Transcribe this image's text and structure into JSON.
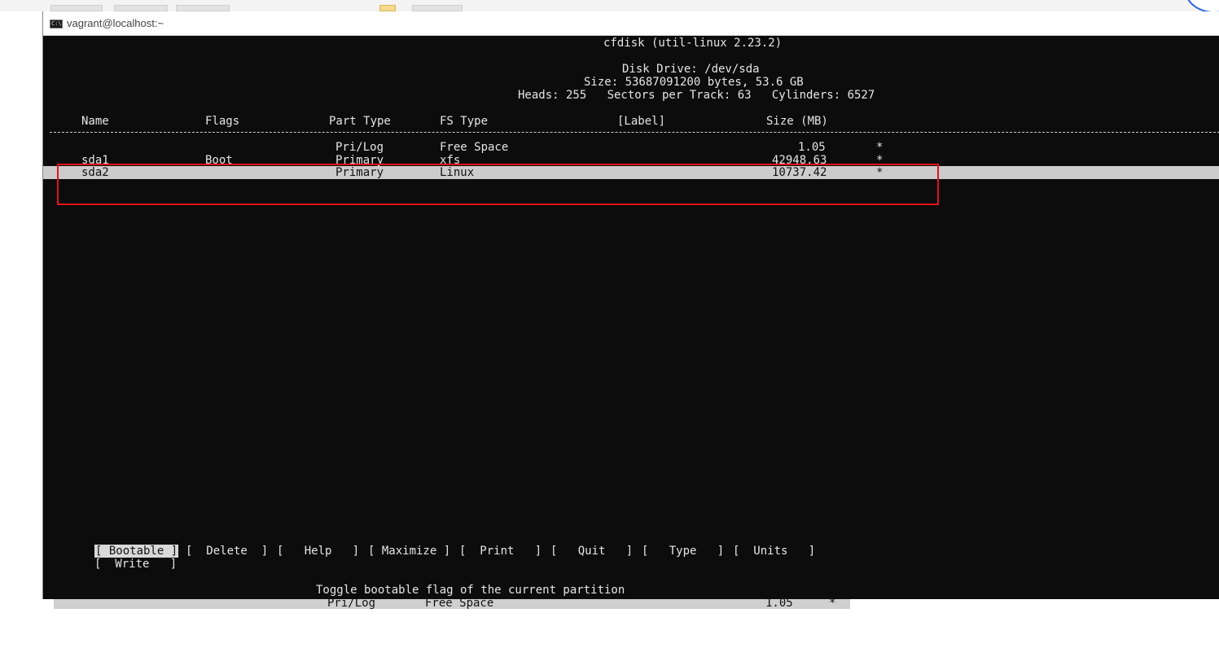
{
  "window": {
    "title": "vagrant@localhost:~",
    "app_icon_text": "C:\\"
  },
  "cfdisk": {
    "version_line": "cfdisk (util-linux 2.23.2)",
    "disk_drive": "Disk Drive: /dev/sda",
    "size_line": "Size: 53687091200 bytes, 53.6 GB",
    "geometry_line": "Heads: 255   Sectors per Track: 63   Cylinders: 6527",
    "columns": [
      "Name",
      "Flags",
      "Part Type",
      "FS Type",
      "[Label]",
      "Size (MB)"
    ],
    "rows": [
      {
        "name": "",
        "flags": "",
        "part_type": "Pri/Log",
        "fs_type": "Free Space",
        "size": "1.05",
        "mark": "*"
      },
      {
        "name": "sda1",
        "flags": "Boot",
        "part_type": "Primary",
        "fs_type": "xfs",
        "size": "42948.63",
        "mark": "*"
      },
      {
        "name": "sda2",
        "flags": "",
        "part_type": "Primary",
        "fs_type": "Linux",
        "size": "10737.42",
        "mark": "*",
        "selected": true
      }
    ],
    "menu": [
      {
        "label": "[ Bootable ]",
        "active": true
      },
      {
        "label": "[  Delete  ]"
      },
      {
        "label": "[   Help   ]"
      },
      {
        "label": "[ Maximize ]"
      },
      {
        "label": "[  Print   ]"
      },
      {
        "label": "[   Quit   ]"
      },
      {
        "label": "[   Type   ]"
      },
      {
        "label": "[  Units   ]"
      },
      {
        "label": "[  Write   ]"
      }
    ],
    "status_line": "Toggle bootable flag of the current partition"
  },
  "behind_window": {
    "part_type": "Pri/Log",
    "fs_type": "Free Space",
    "size": "1.05",
    "mark": "*"
  },
  "colors": {
    "terminal_bg": "#0c0c0c",
    "terminal_fg": "#e6e6e6",
    "highlight": "#cccccc",
    "annotation_red": "#e0141a"
  }
}
